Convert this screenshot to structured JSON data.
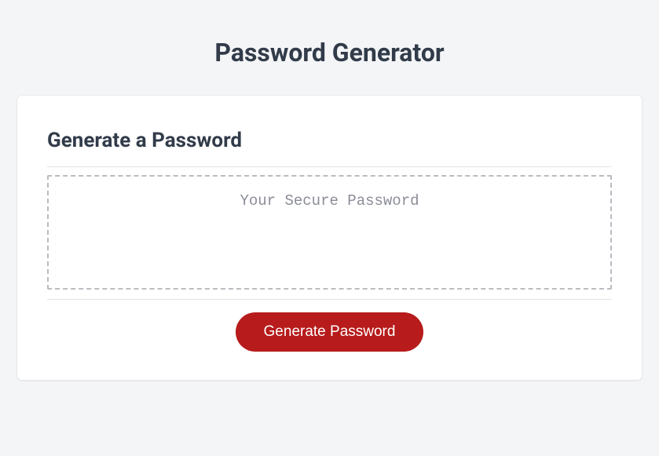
{
  "header": {
    "title": "Password Generator"
  },
  "card": {
    "heading": "Generate a Password",
    "password_placeholder": "Your Secure Password",
    "generate_label": "Generate Password"
  }
}
